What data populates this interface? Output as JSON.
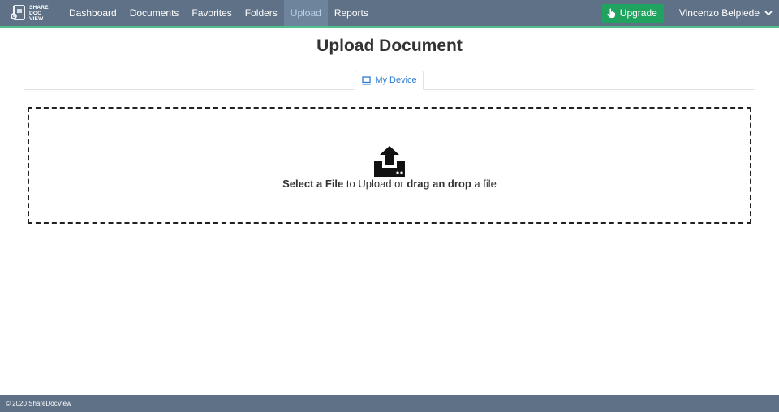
{
  "brand": {
    "line1": "SHARE",
    "line2": "DOC",
    "line3": "VIEW"
  },
  "nav": {
    "items": [
      {
        "label": "Dashboard"
      },
      {
        "label": "Documents"
      },
      {
        "label": "Favorites"
      },
      {
        "label": "Folders"
      },
      {
        "label": "Upload",
        "active": true
      },
      {
        "label": "Reports"
      }
    ],
    "upgrade_label": "Upgrade",
    "user_name": "Vincenzo Belpiede"
  },
  "colors": {
    "navbar": "#5f7186",
    "accent": "#4fc18a",
    "upgrade": "#20a35f",
    "tab_text": "#2b7bd1"
  },
  "icons": {
    "brand": "sharedocview-logo-icon",
    "upgrade": "hand-pointer-icon",
    "user_menu": "chevron-down-icon",
    "tab": "laptop-icon",
    "dropzone": "upload-icon"
  },
  "main": {
    "title": "Upload Document",
    "tabs": [
      {
        "label": "My Device"
      }
    ],
    "dropzone": {
      "select_file": "Select a File",
      "to_upload_or": " to Upload or ",
      "drag_drop": "drag an drop",
      "a_file": " a file"
    }
  },
  "footer": {
    "text": "© 2020 ShareDocView"
  }
}
